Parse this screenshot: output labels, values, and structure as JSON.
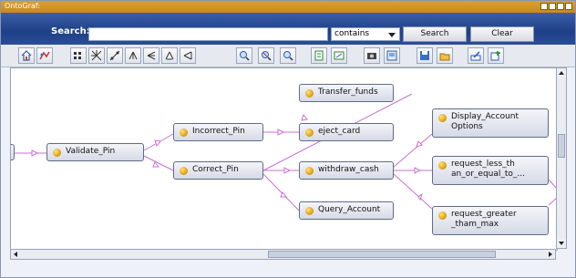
{
  "window": {
    "title": "OntoGraf:"
  },
  "search": {
    "label": "Search:",
    "value": "",
    "mode": "contains",
    "search_button": "Search",
    "clear_button": "Clear"
  },
  "toolbar": {
    "icons": [
      "home-icon",
      "collapse-icon",
      "grid-layout-icon",
      "spring-layout-icon",
      "radial-layout-icon",
      "tree-down-icon",
      "tree-left-icon",
      "vertical-tree-icon",
      "horizontal-tree-icon",
      "zoom-in-icon",
      "zoom-reset-icon",
      "zoom-out-icon",
      "filter-icon",
      "config-icon",
      "snapshot-icon",
      "export-icon",
      "save-icon",
      "open-icon",
      "edit-icon",
      "add-icon"
    ]
  },
  "graph": {
    "nodes": [
      {
        "id": "validate_pin",
        "label": "Validate_Pin"
      },
      {
        "id": "incorrect_pin",
        "label": "Incorrect_Pin"
      },
      {
        "id": "correct_pin",
        "label": "Correct_Pin"
      },
      {
        "id": "transfer_funds",
        "label": "Transfer_funds"
      },
      {
        "id": "eject_card",
        "label": "eject_card"
      },
      {
        "id": "withdraw_cash",
        "label": "withdraw_cash"
      },
      {
        "id": "query_account",
        "label": "Query_Account"
      },
      {
        "id": "display_account_options",
        "label": "Display_Account Options"
      },
      {
        "id": "request_less",
        "label": "request_less_th an_or_equal_to_..."
      },
      {
        "id": "request_greater",
        "label": "request_greater _tham_max"
      }
    ],
    "edge_color": "#c86fd6"
  }
}
